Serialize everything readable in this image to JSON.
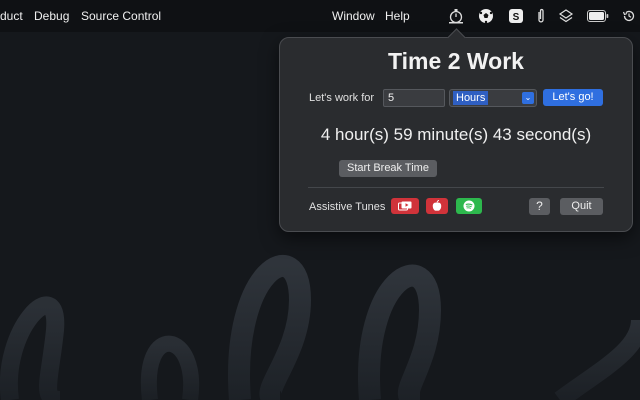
{
  "menubar": {
    "items_left": [
      "duct",
      "Debug",
      "Source Control"
    ],
    "items_right": [
      "Window",
      "Help"
    ],
    "status_icons": [
      "time2work-timer-icon",
      "soccer-ball-icon",
      "skype-icon",
      "paperclip-icon",
      "layers-icon",
      "battery-icon",
      "clock-history-icon"
    ]
  },
  "popover": {
    "title": "Time 2 Work",
    "work_label": "Let's work for",
    "duration_value": "5",
    "unit_selected": "Hours",
    "go_label": "Let's go!",
    "countdown": "4 hour(s) 59 minute(s) 43 second(s)",
    "break_label": "Start Break Time",
    "tunes_label": "Assistive Tunes",
    "tune_buttons": [
      "youtube-icon",
      "apple-music-icon",
      "spotify-icon"
    ],
    "help_label": "?",
    "quit_label": "Quit"
  },
  "colors": {
    "accent_blue": "#2f6fe0",
    "youtube_red": "#d0333a",
    "apple_red": "#d0333a",
    "spotify_green": "#2db84d"
  }
}
